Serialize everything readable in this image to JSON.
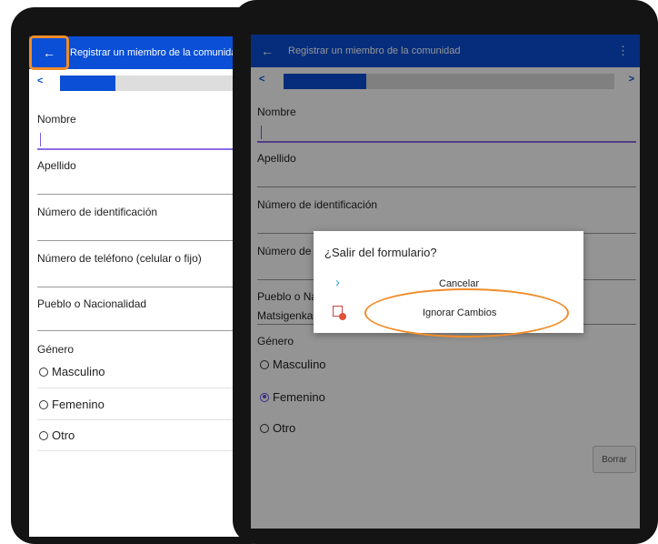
{
  "left_screen": {
    "app_title": "Registrar un miembro de la comunidad",
    "fields": [
      {
        "label": "Nombre",
        "value": ""
      },
      {
        "label": "Apellido",
        "value": ""
      },
      {
        "label": "Número de identificación",
        "value": ""
      },
      {
        "label": "Número de teléfono (celular o fijo)",
        "value": ""
      },
      {
        "label": "Pueblo o Nacionalidad",
        "value": ""
      }
    ],
    "gender": {
      "label": "Género",
      "options": [
        "Masculino",
        "Femenino",
        "Otro"
      ],
      "selected": ""
    },
    "progress": 0.3
  },
  "right_screen": {
    "app_title": "Registrar un miembro de la comunidad",
    "fields": [
      {
        "label": "Nombre",
        "value": ""
      },
      {
        "label": "Apellido",
        "value": ""
      },
      {
        "label": "Número de identificación",
        "value": ""
      },
      {
        "label": "Número de",
        "value": ""
      },
      {
        "label": "Pueblo o Na",
        "value": "Matsigenka"
      }
    ],
    "gender": {
      "label": "Género",
      "options": [
        "Masculino",
        "Femenino",
        "Otro"
      ],
      "selected": "Femenino"
    },
    "delete_button": "Borrar",
    "progress": 0.25,
    "dialog": {
      "title": "¿Salir del formulario?",
      "cancel_label": "Cancelar",
      "discard_label": "Ignorar Cambios"
    }
  },
  "icons": {
    "back": "arrow-left-icon",
    "prev": "chevron-left-icon",
    "next": "chevron-right-icon",
    "menu": "more-vert-icon",
    "cancel": "chevron-right-icon",
    "discard": "discard-form-icon"
  },
  "colors": {
    "appbar": "#0a4fd6",
    "highlight": "#f28c28",
    "radio_selected": "#6a4fe0",
    "input_active": "#8a6de6"
  }
}
